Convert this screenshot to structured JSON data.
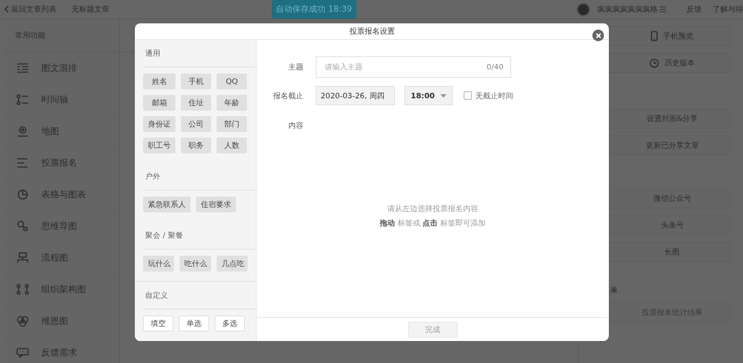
{
  "topbar": {
    "back_link": "返回文章列表",
    "doc_title": "无标题文章",
    "save_status": "自动保存成功 18:39",
    "user_name": "疯疯疯疯疯疯疯格",
    "links": [
      "反馈",
      "了解与得"
    ]
  },
  "sidebar": {
    "title": "常用功能",
    "items": [
      {
        "label": "图文混排"
      },
      {
        "label": "时间轴"
      },
      {
        "label": "地图"
      },
      {
        "label": "投票报名"
      },
      {
        "label": "表格与图表"
      },
      {
        "label": "思维导图"
      },
      {
        "label": "流程图"
      },
      {
        "label": "组织架构图"
      },
      {
        "label": "维恩图"
      },
      {
        "label": "反馈需求"
      }
    ]
  },
  "right_panel": {
    "groups": [
      [
        {
          "label": "手机预览"
        },
        {
          "label": "历史版本"
        }
      ],
      [
        {
          "label": "设置封面&分享"
        },
        {
          "label": "更新已分享文章"
        }
      ],
      [
        {
          "label": "微信公众号"
        },
        {
          "label": "头条号"
        },
        {
          "label": "长图"
        }
      ]
    ],
    "result_label": "果",
    "result_button": {
      "label": "投票报名统计结果",
      "disabled": true
    }
  },
  "modal": {
    "title": "投票报名设置",
    "tag_groups": [
      {
        "title": "通用",
        "kind": "preset",
        "tags": [
          "姓名",
          "手机",
          "QQ",
          "邮箱",
          "住址",
          "年龄",
          "身份证",
          "公司",
          "部门",
          "职工号",
          "职务",
          "人数"
        ]
      },
      {
        "title": "户外",
        "kind": "preset",
        "tags": [
          "紧急联系人",
          "住宿要求"
        ]
      },
      {
        "title": "聚会 / 聚餐",
        "kind": "preset",
        "tags": [
          "玩什么",
          "吃什么",
          "几点吃"
        ]
      },
      {
        "title": "自定义",
        "kind": "custom",
        "tags": [
          "填空",
          "单选",
          "多选"
        ]
      }
    ],
    "form": {
      "subject_label": "主题",
      "subject_placeholder": "请输入主题",
      "subject_counter": "0/40",
      "deadline_label": "报名截止",
      "date": "2020-03-26, 周四",
      "time": "18:00",
      "no_deadline_label": "无截止时间",
      "no_deadline_checked": false,
      "content_label": "内容",
      "hint": "请从左边选择投票报名内容",
      "hint_2": "**拖动** 标签或 **点击** 标签即可添加"
    },
    "done_button": {
      "label": "完成",
      "disabled": true
    }
  }
}
